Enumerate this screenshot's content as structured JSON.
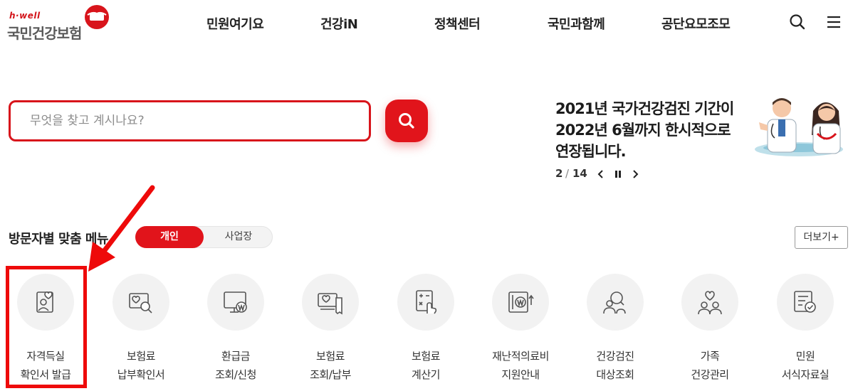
{
  "header": {
    "logo_tag": "h·well",
    "logo_name": "국민건강보험",
    "nav": [
      "민원여기요",
      "건강iN",
      "정책센터",
      "국민과함께",
      "공단요모조모"
    ],
    "icons": {
      "search": "search-icon",
      "menu": "hamburger-menu-icon"
    }
  },
  "search": {
    "placeholder": "무엇을 찾고 계시나요?",
    "value": "",
    "button_icon": "search-icon"
  },
  "notice": {
    "lines": [
      "2021년 국가건강검진 기간이",
      "2022년 6월까지 한시적으로",
      "연장됩니다."
    ],
    "current": "2",
    "separator": "/",
    "total": "14",
    "controls": [
      "prev-arrow-icon",
      "pause-icon",
      "next-arrow-icon"
    ]
  },
  "section": {
    "title": "방문자별 맞춤 메뉴",
    "toggle_active": "개인",
    "toggle_inactive": "사업장",
    "more": "더보기+"
  },
  "menus": [
    {
      "icon": "id-card-heart-icon",
      "line1": "자격득실",
      "line2": "확인서 발급"
    },
    {
      "icon": "payment-search-icon",
      "line1": "보험료",
      "line2": "납부확인서"
    },
    {
      "icon": "monitor-won-icon",
      "line1": "환급금",
      "line2": "조회/신청"
    },
    {
      "icon": "receipt-heart-icon",
      "line1": "보험료",
      "line2": "조회/납부"
    },
    {
      "icon": "calculator-hand-icon",
      "line1": "보험료",
      "line2": "계산기"
    },
    {
      "icon": "medical-support-won-icon",
      "line1": "재난적의료비",
      "line2": "지원안내"
    },
    {
      "icon": "people-search-icon",
      "line1": "건강검진",
      "line2": "대상조회"
    },
    {
      "icon": "family-heart-icon",
      "line1": "가족",
      "line2": "건강관리"
    },
    {
      "icon": "document-check-icon",
      "line1": "민원",
      "line2": "서식자료실"
    }
  ],
  "colors": {
    "brand_red": "#e1141b",
    "text_dark": "#222222",
    "icon_bg": "#f2f2f2",
    "annotation_red": "#ee0a0a"
  }
}
